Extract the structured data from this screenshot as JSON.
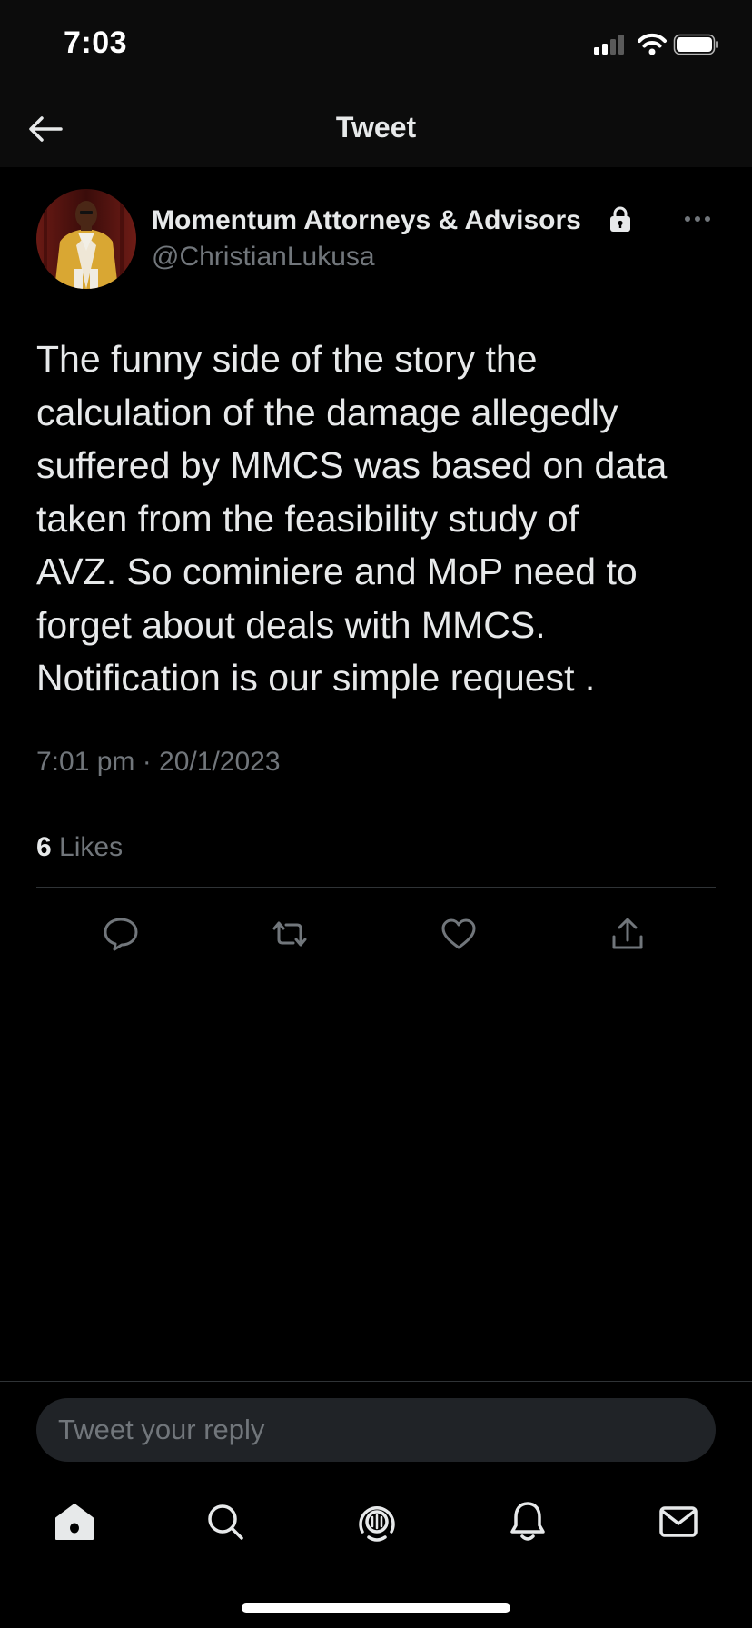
{
  "status_bar": {
    "time": "7:03",
    "icons": [
      "cellular-signal-icon",
      "wifi-icon",
      "battery-icon"
    ]
  },
  "header": {
    "title": "Tweet",
    "back_icon": "back-arrow-icon"
  },
  "tweet": {
    "author_name": "Momentum Attorneys & Advisors",
    "author_handle": "@ChristianLukusa",
    "protected_icon": "lock-icon",
    "more_icon": "more-horizontal-icon",
    "text_lines": [
      "The funny side of the story the",
      "calculation of the damage allegedly",
      "suffered by MMCS was based on data",
      "taken from the feasibility study of",
      "AVZ. So cominiere and MoP need to",
      "forget about deals with MMCS.",
      "Notification is our simple request ."
    ],
    "timestamp": "7:01 pm · 20/1/2023",
    "likes_count": "6",
    "likes_label": "Likes",
    "actions": [
      "reply-icon",
      "retweet-icon",
      "like-icon",
      "share-icon"
    ]
  },
  "reply": {
    "placeholder": "Tweet your reply"
  },
  "tab_bar": {
    "tabs": [
      "home-icon",
      "search-icon",
      "spaces-icon",
      "notifications-icon",
      "messages-icon"
    ],
    "active": "home"
  },
  "colors": {
    "background": "#000000",
    "bar_background": "#0c0c0c",
    "text_primary": "#e7e9ea",
    "text_secondary": "#71767b",
    "divider": "#2f3336",
    "input_background": "#202327"
  }
}
